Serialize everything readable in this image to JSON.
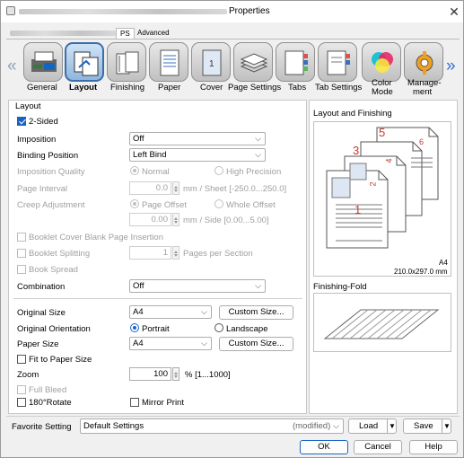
{
  "window": {
    "title": "Properties",
    "close_glyph": "✕"
  },
  "tabs": [
    {
      "label": "PS"
    },
    {
      "label": "Advanced"
    }
  ],
  "categories": [
    {
      "label": "General",
      "icon": "general-icon"
    },
    {
      "label": "Layout",
      "icon": "layout-icon"
    },
    {
      "label": "Finishing",
      "icon": "finishing-icon"
    },
    {
      "label": "Paper",
      "icon": "paper-icon"
    },
    {
      "label": "Cover",
      "icon": "cover-icon"
    },
    {
      "label": "Page Settings",
      "icon": "page-settings-icon"
    },
    {
      "label": "Tabs",
      "icon": "tabs-icon"
    },
    {
      "label": "Tab Settings",
      "icon": "tab-settings-icon"
    },
    {
      "label": "Color",
      "label2": "Mode",
      "icon": "color-mode-icon"
    },
    {
      "label": "Manage-",
      "label2": "ment",
      "icon": "management-icon"
    }
  ],
  "nav": {
    "left": "«",
    "right": "»"
  },
  "layout": {
    "group_label": "Layout",
    "two_sided": {
      "label": "2-Sided",
      "checked": true
    },
    "imposition": {
      "label": "Imposition",
      "value": "Off"
    },
    "binding_position": {
      "label": "Binding Position",
      "value": "Left Bind"
    },
    "imposition_quality": {
      "label": "Imposition Quality",
      "opt1": "Normal",
      "opt2": "High Precision"
    },
    "page_interval": {
      "label": "Page Interval",
      "value": "0.0",
      "unit": "mm / Sheet [-250.0...250.0]"
    },
    "creep_adjustment": {
      "label": "Creep Adjustment",
      "opt1": "Page Offset",
      "opt2": "Whole Offset",
      "value": "0.00",
      "unit": "mm / Side [0.00...5.00]"
    },
    "booklet_cover": {
      "label": "Booklet Cover Blank Page Insertion"
    },
    "booklet_splitting": {
      "label": "Booklet Splitting",
      "value": "1",
      "unit": "Pages per Section"
    },
    "book_spread": {
      "label": "Book Spread"
    },
    "combination": {
      "label": "Combination",
      "value": "Off"
    },
    "original_size": {
      "label": "Original Size",
      "value": "A4",
      "button": "Custom Size..."
    },
    "original_orientation": {
      "label": "Original Orientation",
      "opt1": "Portrait",
      "opt2": "Landscape"
    },
    "paper_size": {
      "label": "Paper Size",
      "value": "A4",
      "button": "Custom Size..."
    },
    "fit_to_paper": {
      "label": "Fit to Paper Size"
    },
    "zoom": {
      "label": "Zoom",
      "value": "100",
      "unit": "% [1...1000]"
    },
    "full_bleed": {
      "label": "Full Bleed"
    },
    "rotate180": {
      "label": "180°Rotate"
    },
    "mirror_print": {
      "label": "Mirror Print"
    }
  },
  "right": {
    "layout_finishing_label": "Layout and Finishing",
    "paper_size_label": "A4",
    "paper_dims": "210.0x297.0 mm",
    "finishing_fold_label": "Finishing-Fold",
    "page_numbers": [
      "1",
      "2",
      "3",
      "4",
      "5",
      "6"
    ]
  },
  "footer": {
    "favorite_label": "Favorite Setting",
    "favorite_value": "Default Settings",
    "modified": "(modified)",
    "load": "Load",
    "save": "Save",
    "ok": "OK",
    "cancel": "Cancel",
    "help": "Help"
  },
  "colors": {
    "accent": "#1a63c6",
    "selected_tab": "#3d6da8",
    "page_number_red": "#c0392b"
  }
}
